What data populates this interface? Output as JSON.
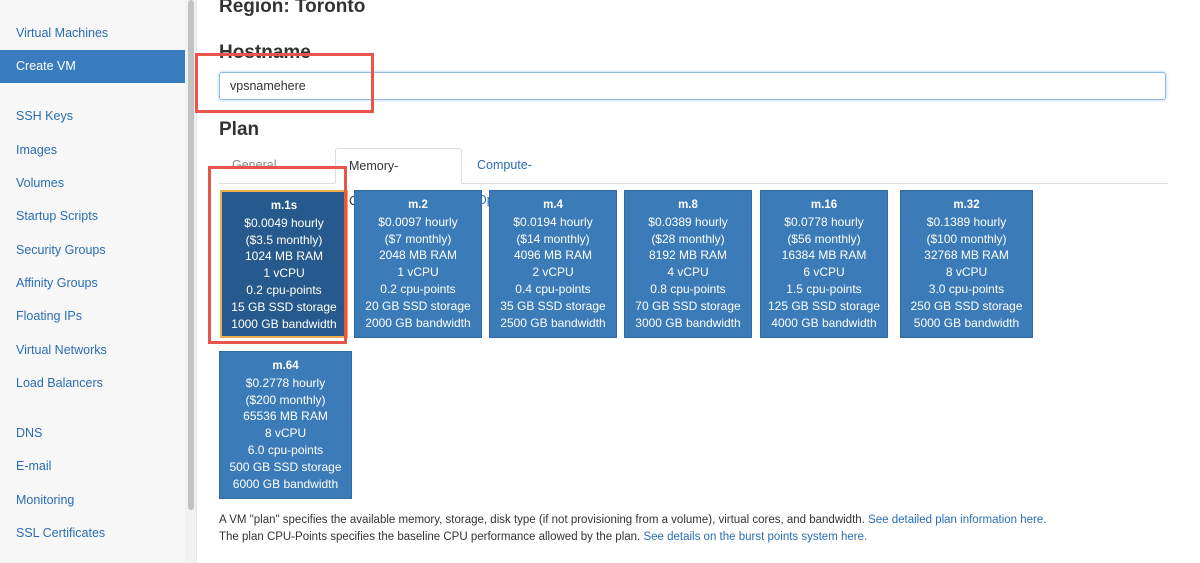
{
  "sidebar": {
    "items": [
      {
        "label": "Virtual Machines",
        "active": false
      },
      {
        "label": "Create VM",
        "active": true
      },
      {
        "label": "SSH Keys",
        "active": false
      },
      {
        "label": "Images",
        "active": false
      },
      {
        "label": "Volumes",
        "active": false
      },
      {
        "label": "Startup Scripts",
        "active": false
      },
      {
        "label": "Security Groups",
        "active": false
      },
      {
        "label": "Affinity Groups",
        "active": false
      },
      {
        "label": "Floating IPs",
        "active": false
      },
      {
        "label": "Virtual Networks",
        "active": false
      },
      {
        "label": "Load Balancers",
        "active": false
      },
      {
        "label": "DNS",
        "active": false
      },
      {
        "label": "E-mail",
        "active": false
      },
      {
        "label": "Monitoring",
        "active": false
      },
      {
        "label": "SSL Certificates",
        "active": false
      }
    ]
  },
  "main": {
    "region_title": "Region: Toronto",
    "hostname_title": "Hostname",
    "hostname_value": "vpsnamehere",
    "plan_title": "Plan",
    "tabs": [
      {
        "label": "General Purpose",
        "active": false
      },
      {
        "label": "Memory-Optimized",
        "active": true
      },
      {
        "label": "Compute-Optimized",
        "active": false
      }
    ],
    "plans": [
      {
        "name": "m.1s",
        "hourly": "$0.0049 hourly",
        "monthly": "($3.5 monthly)",
        "ram": "1024 MB RAM",
        "vcpu": "1 vCPU",
        "cpu_points": "0.2 cpu-points",
        "storage": "15 GB SSD storage",
        "bandwidth": "1000 GB bandwidth",
        "selected": true
      },
      {
        "name": "m.2",
        "hourly": "$0.0097 hourly",
        "monthly": "($7 monthly)",
        "ram": "2048 MB RAM",
        "vcpu": "1 vCPU",
        "cpu_points": "0.2 cpu-points",
        "storage": "20 GB SSD storage",
        "bandwidth": "2000 GB bandwidth",
        "selected": false
      },
      {
        "name": "m.4",
        "hourly": "$0.0194 hourly",
        "monthly": "($14 monthly)",
        "ram": "4096 MB RAM",
        "vcpu": "2 vCPU",
        "cpu_points": "0.4 cpu-points",
        "storage": "35 GB SSD storage",
        "bandwidth": "2500 GB bandwidth",
        "selected": false
      },
      {
        "name": "m.8",
        "hourly": "$0.0389 hourly",
        "monthly": "($28 monthly)",
        "ram": "8192 MB RAM",
        "vcpu": "4 vCPU",
        "cpu_points": "0.8 cpu-points",
        "storage": "70 GB SSD storage",
        "bandwidth": "3000 GB bandwidth",
        "selected": false
      },
      {
        "name": "m.16",
        "hourly": "$0.0778 hourly",
        "monthly": "($56 monthly)",
        "ram": "16384 MB RAM",
        "vcpu": "6 vCPU",
        "cpu_points": "1.5 cpu-points",
        "storage": "125 GB SSD storage",
        "bandwidth": "4000 GB bandwidth",
        "selected": false
      },
      {
        "name": "m.32",
        "hourly": "$0.1389 hourly",
        "monthly": "($100 monthly)",
        "ram": "32768 MB RAM",
        "vcpu": "8 vCPU",
        "cpu_points": "3.0 cpu-points",
        "storage": "250 GB SSD storage",
        "bandwidth": "5000 GB bandwidth",
        "selected": false
      },
      {
        "name": "m.64",
        "hourly": "$0.2778 hourly",
        "monthly": "($200 monthly)",
        "ram": "65536 MB RAM",
        "vcpu": "8 vCPU",
        "cpu_points": "6.0 cpu-points",
        "storage": "500 GB SSD storage",
        "bandwidth": "6000 GB bandwidth",
        "selected": false
      }
    ],
    "info_line1": "A VM \"plan\" specifies the available memory, storage, disk type (if not provisioning from a volume), virtual cores, and bandwidth.",
    "info_link1": "See detailed plan information here.",
    "info_line2": "The plan CPU-Points specifies the baseline CPU performance allowed by the plan.",
    "info_link2": "See details on the burst points system here."
  },
  "colors": {
    "card_bg": "#3a7bb8",
    "card_selected_bg": "#275a8c",
    "selected_outline": "#f0ad4e",
    "annotation": "#e8554a",
    "link": "#2a6db3",
    "nav_active": "#3a7cc0"
  }
}
